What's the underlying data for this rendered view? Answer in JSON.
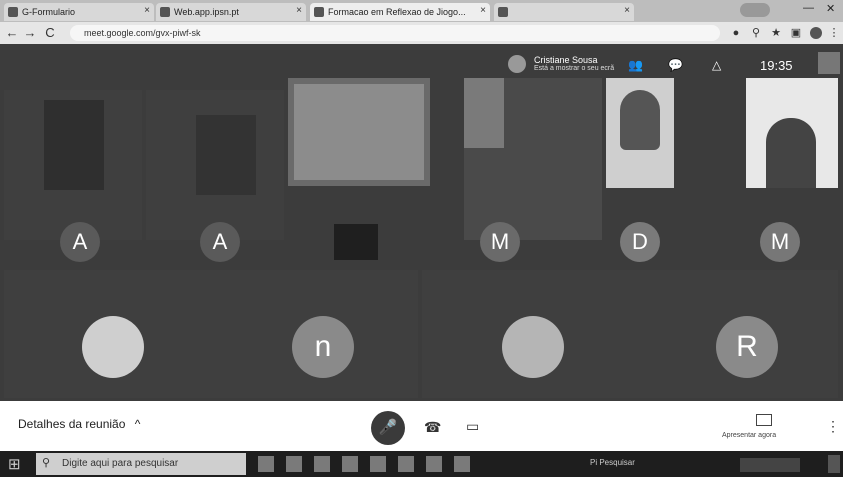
{
  "browser": {
    "tabs": [
      {
        "label": "G-Formulario",
        "close": "×"
      },
      {
        "label": "Web.app.ipsn.pt",
        "close": "×"
      },
      {
        "label": "Formacao em Reflexao de Jiogo...",
        "close": "×"
      },
      {
        "label": "",
        "close": "×"
      }
    ],
    "back_icon": "←",
    "forward_icon": "→",
    "reload_icon": "C",
    "url": "meet.google.com/gvx-piwf-sk",
    "window_controls": {
      "minimize": "—",
      "close": "✕"
    }
  },
  "meeting": {
    "presenter_name": "Cristiane Sousa",
    "presenter_sub": "Está a mostrar o seu ecrã",
    "clock": "19:35",
    "participants_row1": [
      {
        "initial": "A",
        "color": "#5a5a5a"
      },
      {
        "initial": "A",
        "color": "#5a5a5a"
      },
      {
        "initial": "",
        "color": "#5a5a5a"
      },
      {
        "initial": "M",
        "color": "#6a6a6a"
      },
      {
        "initial": "D",
        "color": "#7a7a7a"
      },
      {
        "initial": "M",
        "color": "#777777"
      }
    ],
    "participants_row2": [
      {
        "initial": "",
        "photo": true
      },
      {
        "initial": "n",
        "color": "#8a8a8a"
      },
      {
        "initial": "",
        "photo": true
      },
      {
        "initial": "R",
        "color": "#8a8a8a"
      }
    ],
    "header_icons": [
      "people-icon",
      "chat-icon",
      "activities-icon"
    ]
  },
  "controls": {
    "details_label": "Detalhes da reunião",
    "details_chevron": "^",
    "mic_icon": "🎤",
    "hangup_icon": "☎",
    "camera_icon": "▭",
    "present_label": "Apresentar agora",
    "more_icon": "⋮"
  },
  "taskbar": {
    "start_icon": "⊞",
    "search_placeholder": "Digite aqui para pesquisar",
    "tray_text": "Pi   Pesquisar",
    "accent_color": "#1e1e1e"
  }
}
